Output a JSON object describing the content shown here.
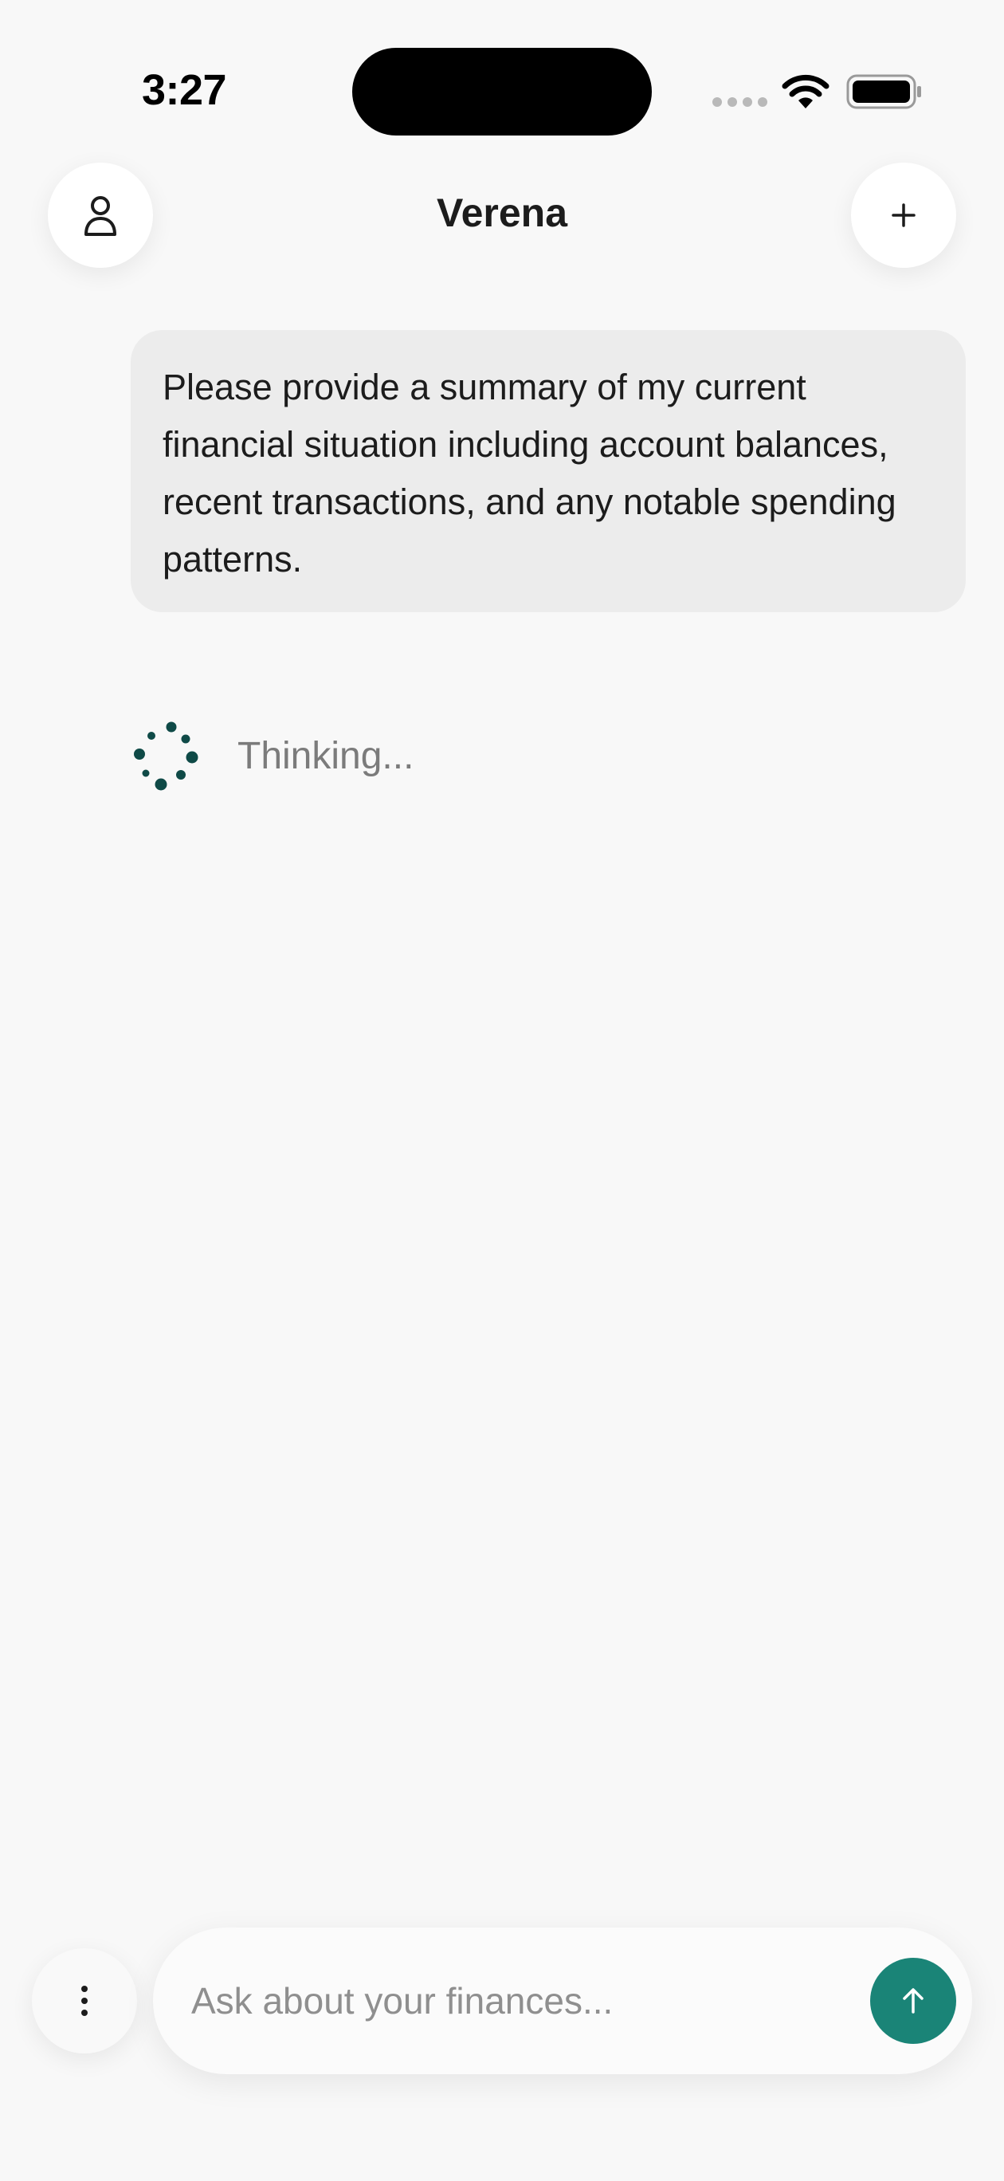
{
  "status_bar": {
    "time": "3:27"
  },
  "header": {
    "title": "Verena",
    "left_icon": "person-icon",
    "right_icon": "plus-icon"
  },
  "messages": [
    {
      "role": "user",
      "text": "Please provide a summary of my current financial situation including account balances, recent transactions, and any notable spending patterns."
    }
  ],
  "thinking": {
    "label": "Thinking...",
    "icon": "loading-spinner-icon"
  },
  "composer": {
    "placeholder": "Ask about your finances...",
    "value": "",
    "send_icon": "arrow-up-icon",
    "menu_icon": "vertical-ellipsis-icon"
  },
  "colors": {
    "accent": "#1a8477",
    "spinner": "#0f4a47",
    "background": "#f8f8f8",
    "user_bubble": "#ececec"
  }
}
